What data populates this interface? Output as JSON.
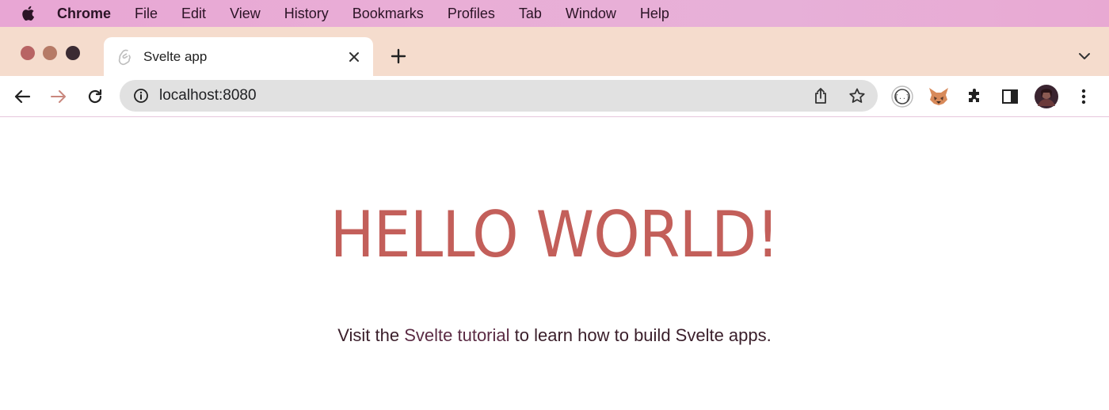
{
  "menubar": {
    "app": "Chrome",
    "items": [
      "File",
      "Edit",
      "View",
      "History",
      "Bookmarks",
      "Profiles",
      "Tab",
      "Window",
      "Help"
    ]
  },
  "tab": {
    "title": "Svelte app"
  },
  "toolbar": {
    "url": "localhost:8080"
  },
  "page": {
    "heading": "HELLO WORLD!",
    "lead_prefix": "Visit the ",
    "lead_link": "Svelte tutorial",
    "lead_suffix": " to learn how to build Svelte apps."
  },
  "colors": {
    "menubar": "#e8a6d4",
    "tabstrip": "#f5dccd",
    "heading": "#c35f5a"
  },
  "icons": [
    "apple-icon",
    "svelte-favicon-icon",
    "close-icon",
    "plus-icon",
    "chevron-down-icon",
    "back-arrow-icon",
    "forward-arrow-icon",
    "reload-icon",
    "info-icon",
    "share-icon",
    "star-icon",
    "devtools-extension-icon",
    "fox-extension-icon",
    "puzzle-icon",
    "side-panel-icon",
    "avatar",
    "kebab-menu-icon"
  ]
}
